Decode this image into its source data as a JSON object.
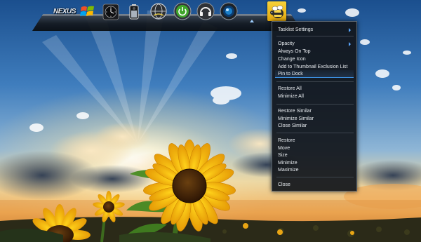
{
  "dock": {
    "logo_text": "NEXUS",
    "icons": [
      {
        "name": "windows-logo-icon"
      },
      {
        "name": "clock-icon"
      },
      {
        "name": "battery-icon"
      },
      {
        "name": "network-globe-icon"
      },
      {
        "name": "power-icon"
      },
      {
        "name": "headphones-icon"
      },
      {
        "name": "camera-lens-icon"
      },
      {
        "name": "winstep-bee-icon",
        "active": true
      }
    ],
    "active_color": "#f2c21d"
  },
  "context_menu": {
    "items": [
      {
        "label": "Tasklist Settings",
        "submenu": true
      },
      {
        "label": "Opacity",
        "submenu": true
      },
      {
        "label": "Always On Top"
      },
      {
        "label": "Change Icon"
      },
      {
        "label": "Add to Thumbnail Exclusion List"
      },
      {
        "label": "Pin to Dock",
        "highlighted": true
      },
      {
        "label": "Restore All"
      },
      {
        "label": "Minimize All"
      },
      {
        "label": "Restore Similar"
      },
      {
        "label": "Minimize Similar"
      },
      {
        "label": "Close Similar"
      },
      {
        "label": "Restore"
      },
      {
        "label": "Move"
      },
      {
        "label": "Size"
      },
      {
        "label": "Minimize"
      },
      {
        "label": "Maximize"
      },
      {
        "label": "Close"
      }
    ],
    "accent_color": "#3b8fe0"
  }
}
